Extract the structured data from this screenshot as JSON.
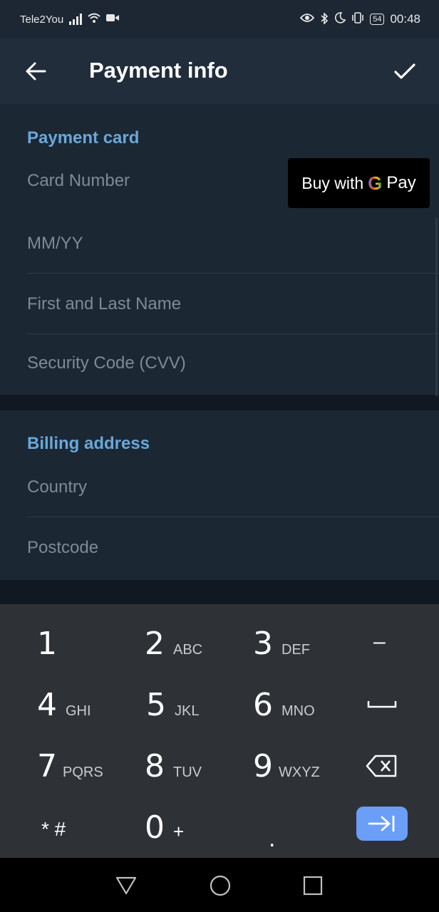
{
  "status_bar": {
    "carrier": "Tele2You",
    "battery": "54",
    "time": "00:48",
    "icons": [
      "signal-icon",
      "wifi-icon",
      "video-icon",
      "eye-icon",
      "bluetooth-icon",
      "moon-icon",
      "vibrate-icon",
      "battery-icon"
    ]
  },
  "app_bar": {
    "title": "Payment info",
    "back_icon": "arrow-left-icon",
    "done_icon": "check-icon"
  },
  "payment_card": {
    "title": "Payment card",
    "card_number_placeholder": "Card Number",
    "expiry_placeholder": "MM/YY",
    "name_placeholder": "First and Last Name",
    "cvv_placeholder": "Security Code (CVV)",
    "gpay": {
      "buy": "Buy with",
      "g": "G",
      "pay": "Pay"
    }
  },
  "billing": {
    "title": "Billing address",
    "country_placeholder": "Country",
    "postcode_placeholder": "Postcode"
  },
  "keyboard": {
    "keys": [
      {
        "num": "1",
        "letters": ""
      },
      {
        "num": "2",
        "letters": "ABC"
      },
      {
        "num": "3",
        "letters": "DEF"
      },
      {
        "num": "4",
        "letters": "GHI"
      },
      {
        "num": "5",
        "letters": "JKL"
      },
      {
        "num": "6",
        "letters": "MNO"
      },
      {
        "num": "7",
        "letters": "PQRS"
      },
      {
        "num": "8",
        "letters": "TUV"
      },
      {
        "num": "9",
        "letters": "WXYZ"
      },
      {
        "num": "0",
        "letters": "+"
      }
    ],
    "minus": "–",
    "star_hash": "* #",
    "dot": ".",
    "space_icon": "space-icon",
    "backspace_icon": "backspace-icon",
    "tab_icon": "tab-next-icon",
    "accent_color": "#6a9ef7"
  },
  "nav_bar": {
    "icons": [
      "back-triangle-icon",
      "home-circle-icon",
      "recents-square-icon"
    ]
  },
  "colors": {
    "accent": "#69a8d9",
    "background": "#1c2734",
    "app_bar": "#212d3b"
  }
}
